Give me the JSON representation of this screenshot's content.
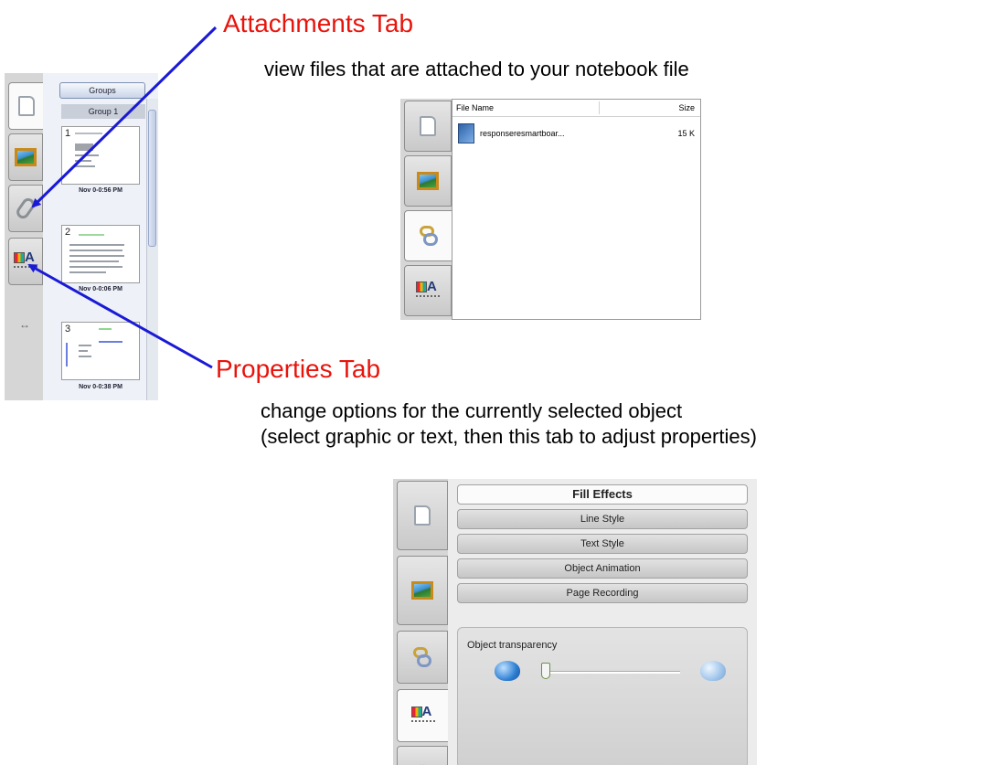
{
  "attachments": {
    "title": "Attachments Tab",
    "description": "view files that are attached to your notebook file"
  },
  "properties": {
    "title": "Properties Tab",
    "description_line1": "change options for the currently selected object",
    "description_line2": "(select graphic or text, then this tab to adjust properties)"
  },
  "page_sorter": {
    "groups_button": "Groups",
    "group_header": "Group 1",
    "pages": [
      {
        "number": "1",
        "date": "Nov 0-0:56 PM"
      },
      {
        "number": "2",
        "date": "Nov 0-0:06 PM"
      },
      {
        "number": "3",
        "date": "Nov 0-0:38 PM"
      }
    ],
    "expand_arrow": "↔"
  },
  "attachments_panel": {
    "col_file_name": "File Name",
    "col_size": "Size",
    "files": [
      {
        "name": "responseresmartboar...",
        "size": "15 K"
      }
    ]
  },
  "properties_panel": {
    "buttons": [
      "Fill Effects",
      "Line Style",
      "Text Style",
      "Object Animation",
      "Page Recording"
    ],
    "active_button": "Fill Effects",
    "transparency_label": "Object transparency",
    "transparency_value": 0.0,
    "expand_arrow": "↔"
  },
  "colors": {
    "title_red": "#e8140c",
    "arrow_blue": "#1a1ad6"
  },
  "icons": [
    "page-sorter-icon",
    "gallery-icon",
    "attachments-icon",
    "properties-icon"
  ]
}
